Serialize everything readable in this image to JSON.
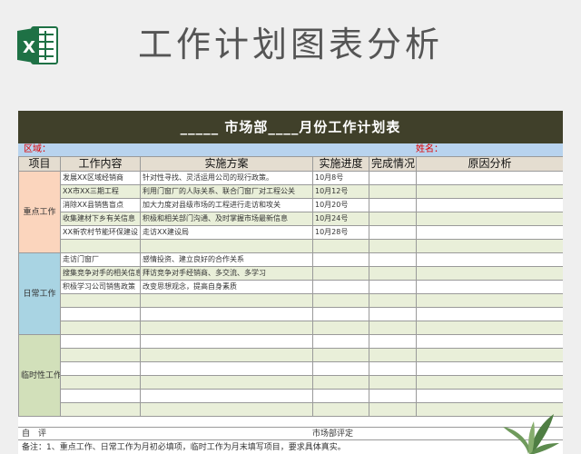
{
  "header": {
    "title": "工作计划图表分析",
    "app_icon": "excel-icon"
  },
  "sheet": {
    "title": "_____ 市场部____月份工作计划表",
    "area_label": "区域：",
    "name_label": "姓名：",
    "columns": [
      "项目",
      "工作内容",
      "实施方案",
      "实施进度",
      "完成情况",
      "原因分析"
    ],
    "categories": {
      "key": "重点工作",
      "daily": "日常工作",
      "temp": "临时性工作"
    },
    "key_rows": [
      {
        "content": "发展XX区域经销商",
        "plan": "针对性寻找、灵活运用公司的现行政策。",
        "progress": "10月8号"
      },
      {
        "content": "XX市XX三期工程",
        "plan": "利用门窗厂的人际关系、联合门窗厂对工程公关",
        "progress": "10月12号"
      },
      {
        "content": "消除XX县销售盲点",
        "plan": "加大力度对县级市场的工程进行走访和攻关",
        "progress": "10月20号"
      },
      {
        "content": "收集建材下乡有关信息",
        "plan": "积极和相关部门沟通、及时掌握市场最新信息",
        "progress": "10月24号"
      },
      {
        "content": "XX新农村节能环保建设",
        "plan": "走访XX建设局",
        "progress": "10月28号"
      }
    ],
    "daily_rows": [
      {
        "content": "走访门窗厂",
        "plan": "感情投资、建立良好的合作关系",
        "progress": ""
      },
      {
        "content": "搜集竞争对手的相关信息",
        "plan": "拜访竞争对手经销商、多交流、多学习",
        "progress": ""
      },
      {
        "content": "积极学习公司销售政策",
        "plan": "改变思想观念，提高自身素质",
        "progress": ""
      }
    ],
    "footer": {
      "self_eval": "自　评",
      "dept_eval": "市场部评定"
    },
    "note": "备注：1、重点工作、日常工作为月初必填项，临时工作为月末填写项目，要求具体真实。"
  },
  "colors": {
    "title_bar": "#40402a",
    "meta_row": "#b8d3ee",
    "alt_row": "#e9efd9",
    "key": "#fbd5bd",
    "daily": "#a9d4e3",
    "temp": "#d2e0ba"
  }
}
